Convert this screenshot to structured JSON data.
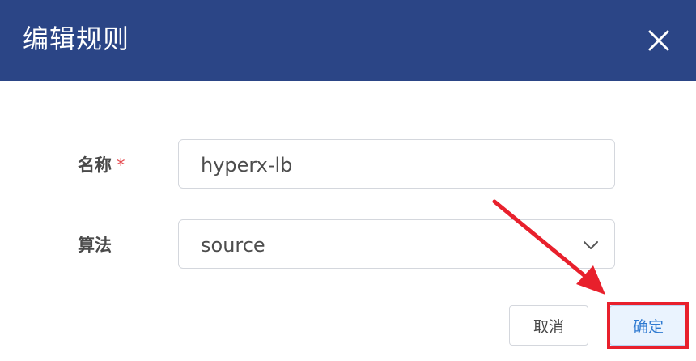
{
  "dialog": {
    "title": "编辑规则",
    "close_icon": "close-icon"
  },
  "form": {
    "name": {
      "label": "名称",
      "required_mark": "*",
      "value": "hyperx-lb"
    },
    "algorithm": {
      "label": "算法",
      "value": "source",
      "dropdown_icon": "chevron-down-icon"
    }
  },
  "footer": {
    "cancel_label": "取消",
    "ok_label": "确定"
  },
  "colors": {
    "header": "#2b4586",
    "accent": "#2f7ad1",
    "annotation": "#e8202c",
    "required": "#e5484d"
  }
}
